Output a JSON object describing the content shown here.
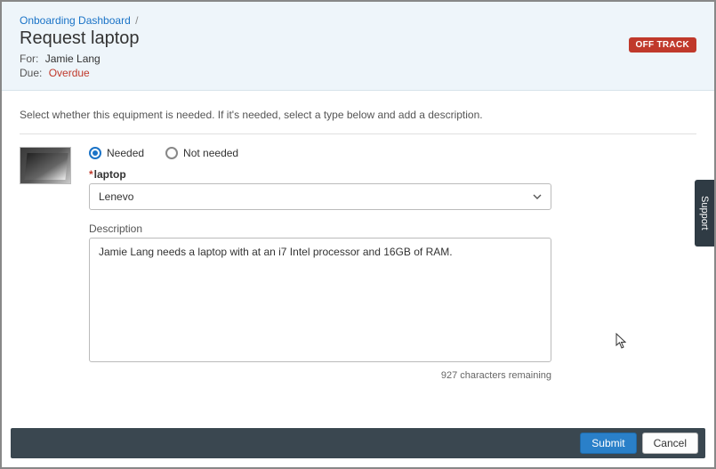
{
  "breadcrumb": {
    "parent": "Onboarding Dashboard",
    "sep": "/"
  },
  "title": "Request laptop",
  "for_label": "For:",
  "for_value": "Jamie Lang",
  "due_label": "Due:",
  "due_value": "Overdue",
  "status_badge": "OFF TRACK",
  "instructions": "Select whether this equipment is needed. If it's needed, select a type below and add a description.",
  "radio": {
    "needed": "Needed",
    "not_needed": "Not needed"
  },
  "field": {
    "laptop_label": "laptop",
    "laptop_value": "Lenevo"
  },
  "description": {
    "label": "Description",
    "value": "Jamie Lang needs a laptop with at an i7 Intel processor and 16GB of RAM.",
    "remaining": "927 characters remaining"
  },
  "support_tab": "Support",
  "buttons": {
    "submit": "Submit",
    "cancel": "Cancel"
  }
}
